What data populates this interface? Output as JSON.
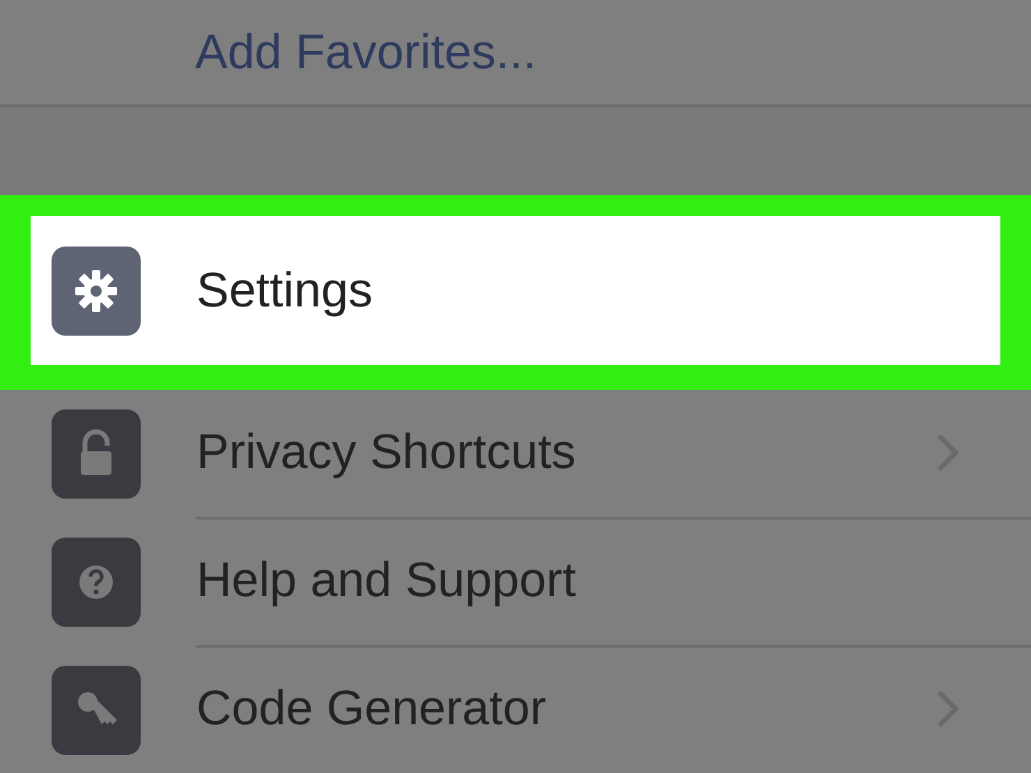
{
  "top_link": {
    "label": "Add Favorites..."
  },
  "menu_items": [
    {
      "kind": "gear",
      "label": "Settings",
      "highlighted": true,
      "chevron": false
    },
    {
      "kind": "lock",
      "label": "Privacy Shortcuts",
      "highlighted": false,
      "chevron": true
    },
    {
      "kind": "help",
      "label": "Help and Support",
      "highlighted": false,
      "chevron": false
    },
    {
      "kind": "key",
      "label": "Code Generator",
      "highlighted": false,
      "chevron": true
    }
  ]
}
